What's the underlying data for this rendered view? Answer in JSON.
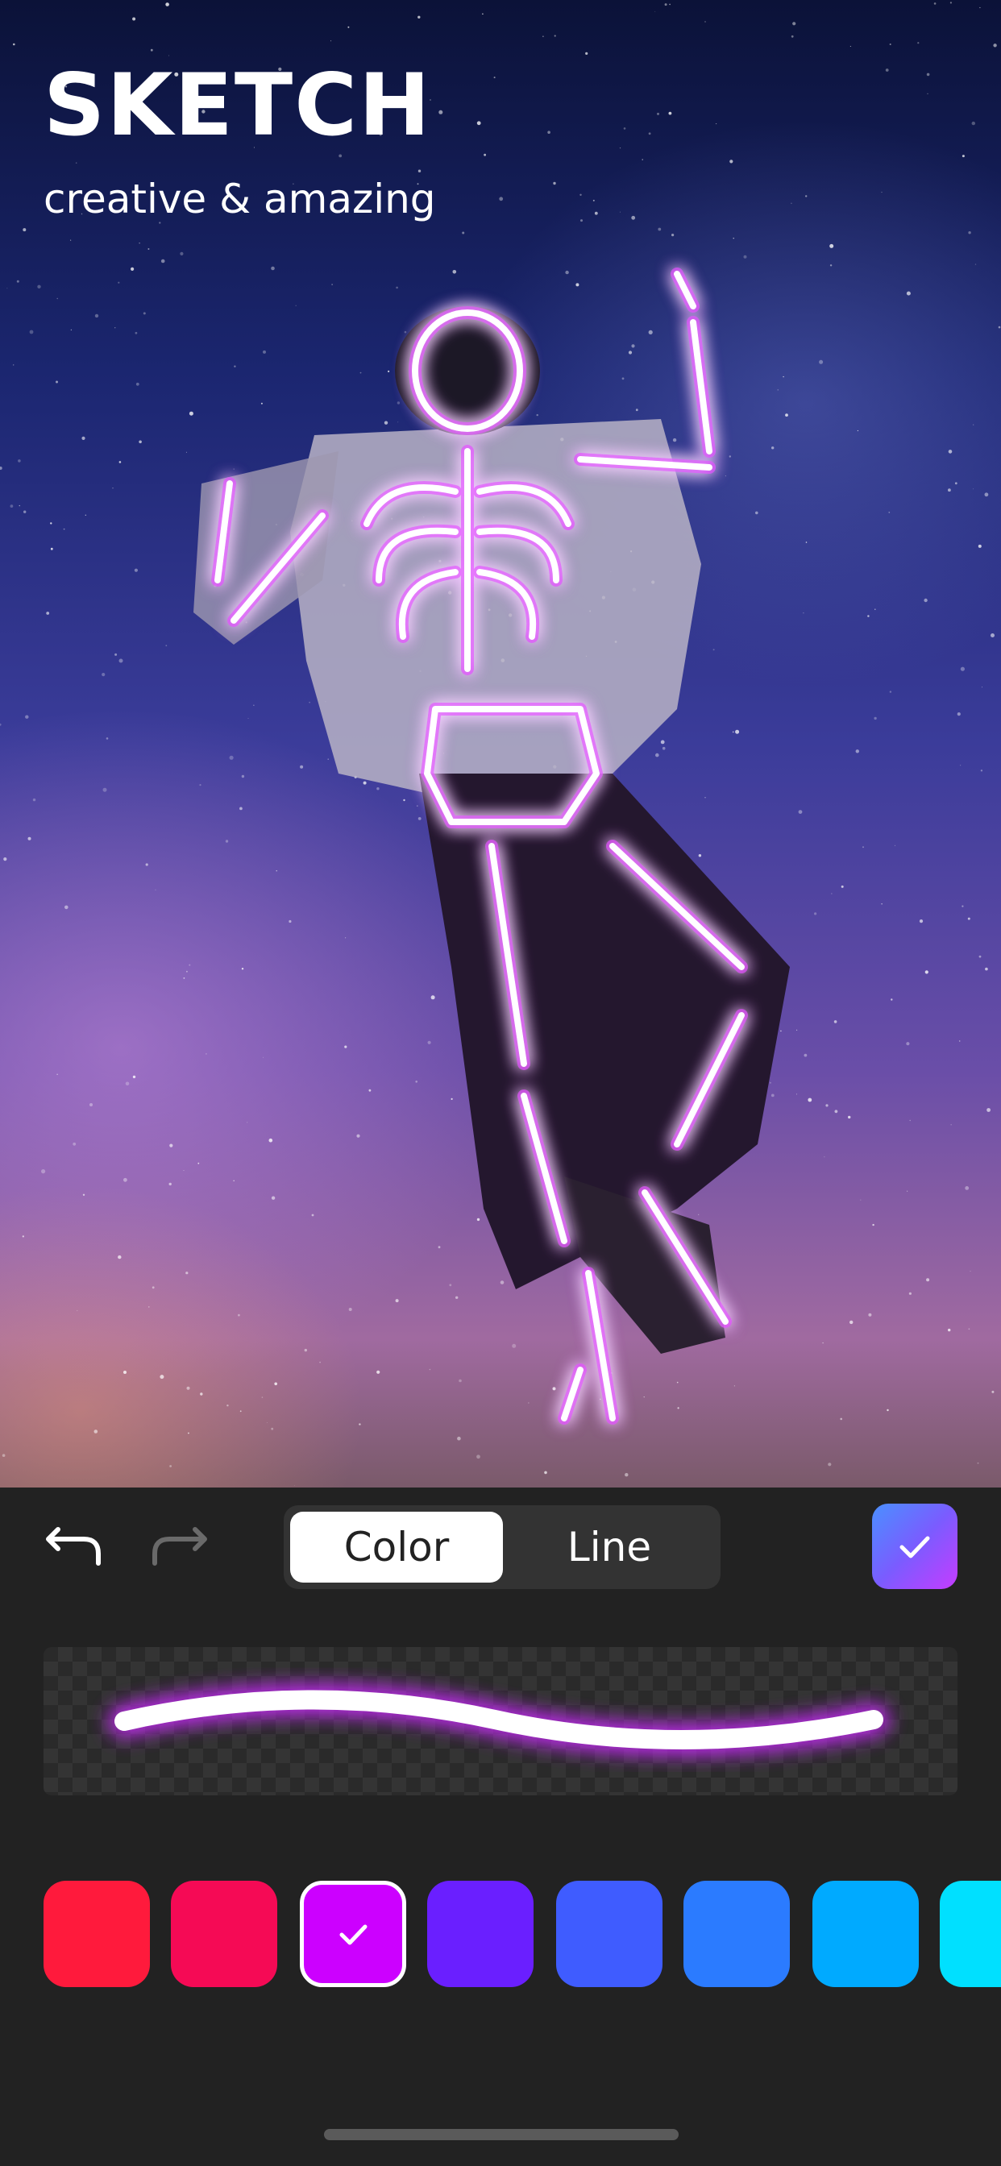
{
  "hero": {
    "title": "SKETCH",
    "subtitle": "creative & amazing",
    "glow_color": "#d23cff"
  },
  "toolbar": {
    "undo_icon": "undo-arrow-icon",
    "redo_icon": "redo-arrow-icon",
    "redo_enabled": false,
    "tabs": [
      {
        "label": "Color",
        "selected": true
      },
      {
        "label": "Line",
        "selected": false
      }
    ],
    "confirm_icon": "checkmark-icon"
  },
  "preview": {
    "stroke_color": "#ffffff",
    "glow_color": "#cc2cff"
  },
  "swatches": [
    {
      "color": "#ff1a3c",
      "selected": false
    },
    {
      "color": "#f50a55",
      "selected": false
    },
    {
      "color": "#cc00ff",
      "selected": true
    },
    {
      "color": "#6a1fff",
      "selected": false
    },
    {
      "color": "#3f5cff",
      "selected": false
    },
    {
      "color": "#2b7bff",
      "selected": false
    },
    {
      "color": "#00aaff",
      "selected": false
    },
    {
      "color": "#00e0ff",
      "selected": false
    }
  ]
}
